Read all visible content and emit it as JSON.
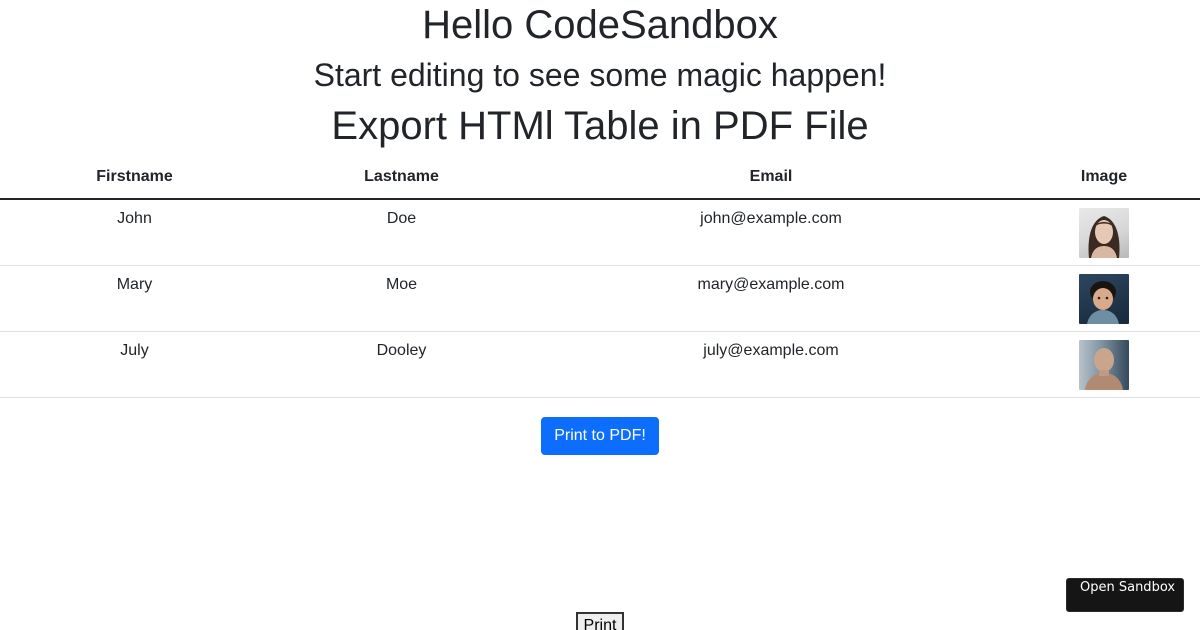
{
  "headings": {
    "hello": "Hello CodeSandbox",
    "subtitle": "Start editing to see some magic happen!",
    "export": "Export HTMl Table in PDF File"
  },
  "table": {
    "columns": [
      "Firstname",
      "Lastname",
      "Email",
      "Image"
    ],
    "rows": [
      {
        "firstname": "John",
        "lastname": "Doe",
        "email": "john@example.com",
        "image": "portrait-woman"
      },
      {
        "firstname": "Mary",
        "lastname": "Moe",
        "email": "mary@example.com",
        "image": "portrait-child"
      },
      {
        "firstname": "July",
        "lastname": "Dooley",
        "email": "july@example.com",
        "image": "portrait-man"
      }
    ]
  },
  "buttons": {
    "print_pdf": "Print to PDF!",
    "print": "Print",
    "open_sandbox": "Open Sandbox"
  },
  "colors": {
    "primary_button": "#0d6efd",
    "sandbox_badge": "#151515"
  }
}
